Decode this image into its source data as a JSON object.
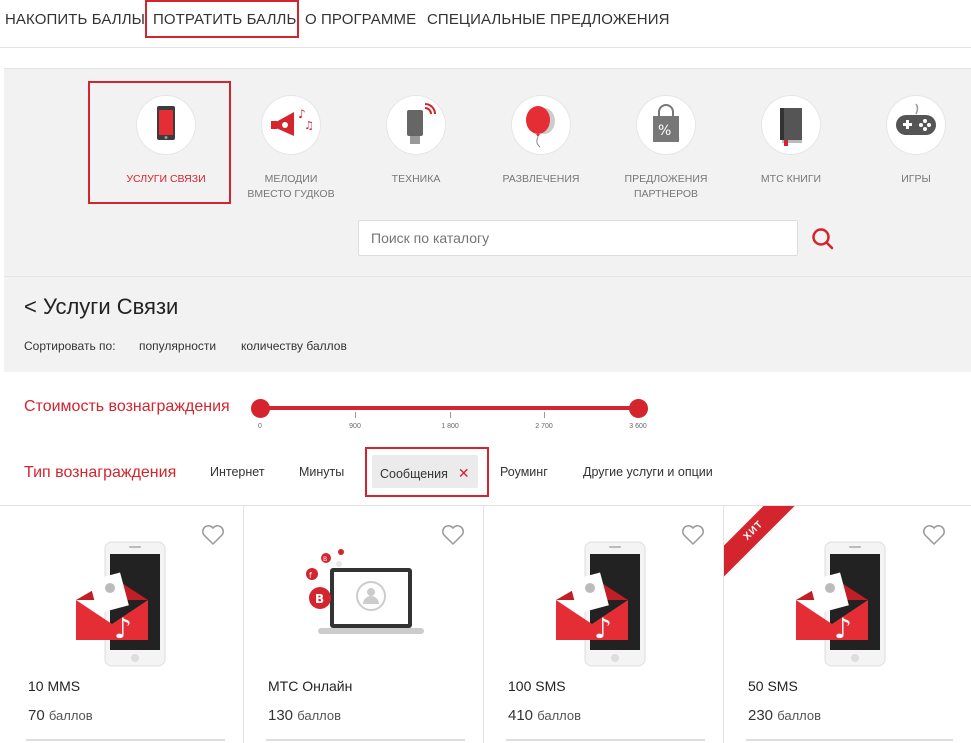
{
  "topnav": {
    "items": [
      "НАКОПИТЬ БАЛЛЫ",
      "ПОТРАТИТЬ БАЛЛЫ",
      "О ПРОГРАММЕ",
      "СПЕЦИАЛЬНЫЕ ПРЕДЛОЖЕНИЯ"
    ],
    "active_index": 1
  },
  "catalog": {
    "categories": [
      {
        "label": "УСЛУГИ СВЯЗИ",
        "icon": "phone-icon",
        "active": true
      },
      {
        "label": "МЕЛОДИИ ВМЕСТО ГУДКОВ",
        "icon": "megaphone-icon",
        "active": false
      },
      {
        "label": "ТЕХНИКА",
        "icon": "usb-modem-icon",
        "active": false
      },
      {
        "label": "РАЗВЛЕЧЕНИЯ",
        "icon": "balloon-icon",
        "active": false
      },
      {
        "label": "ПРЕДЛОЖЕНИЯ ПАРТНЕРОВ",
        "icon": "shopping-bag-percent-icon",
        "active": false
      },
      {
        "label": "МТС КНИГИ",
        "icon": "book-icon",
        "active": false
      },
      {
        "label": "ИГРЫ",
        "icon": "gamepad-icon",
        "active": false
      }
    ],
    "search_placeholder": "Поиск по каталогу"
  },
  "section": {
    "title": "< Услуги Связи",
    "sort_label": "Сортировать по:",
    "sort_options": [
      "популярности",
      "количеству баллов"
    ]
  },
  "filters": {
    "cost_title": "Стоимость вознаграждения",
    "cost_ticks": [
      "0",
      "900",
      "1 800",
      "2 700",
      "3 600"
    ],
    "cost_range": [
      0,
      3600
    ],
    "type_title": "Тип вознаграждения",
    "types": [
      "Интернет",
      "Минуты",
      "Сообщения",
      "Роуминг",
      "Другие услуги и опции"
    ],
    "active_type": "Сообщения",
    "remove_symbol": "✕"
  },
  "products": [
    {
      "name": "10 MMS",
      "points": "70",
      "unit": "баллов",
      "badge": "",
      "image": "phone-envelope-image"
    },
    {
      "name": "МТС Онлайн",
      "points": "130",
      "unit": "баллов",
      "badge": "",
      "image": "laptop-social-image"
    },
    {
      "name": "100 SMS",
      "points": "410",
      "unit": "баллов",
      "badge": "",
      "image": "phone-envelope-image"
    },
    {
      "name": "50 SMS",
      "points": "230",
      "unit": "баллов",
      "badge": "ХИТ",
      "image": "phone-envelope-image"
    }
  ],
  "colors": {
    "accent": "#d4242e",
    "panel_bg": "#f2f2f2"
  }
}
